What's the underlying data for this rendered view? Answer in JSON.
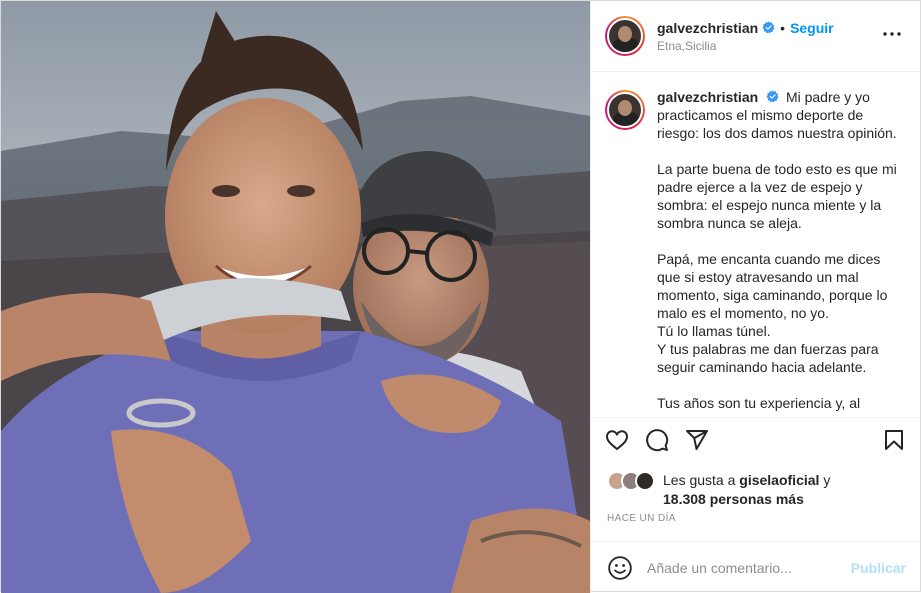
{
  "post": {
    "username": "galvezchristian",
    "verified": true,
    "follow_label": "Seguir",
    "location": "Etna,Sicilia",
    "more_label": "•••"
  },
  "caption": {
    "username": "galvezchristian",
    "paragraphs": [
      "Mi padre y yo practicamos el mismo deporte de riesgo: los dos damos nuestra opinión.",
      "La parte buena de todo esto es que mi padre ejerce a la vez de espejo y sombra: el espejo nunca miente y la sombra nunca se aleja.",
      "Papá, me encanta cuando me dices que si estoy atravesando un mal momento, siga caminando, porque lo malo es el momento, no yo.",
      "Tú lo llamas túnel.",
      "Y tus palabras me dan fuerzas para seguir caminando hacia adelante.",
      "Tus años son tu experiencia y, al"
    ]
  },
  "actions": {
    "icons": [
      "heart-icon",
      "comment-icon",
      "share-icon",
      "bookmark-icon"
    ]
  },
  "likes": {
    "prefix": "Les gusta a",
    "user": "giselaoficial",
    "connector": "y",
    "count": "18.308 personas más"
  },
  "timestamp": "HACE UN DÍA",
  "comment": {
    "placeholder": "Añade un comentario...",
    "publish_label": "Publicar"
  },
  "colors": {
    "accent": "#0095f6",
    "publish_disabled": "#b2dffc",
    "secondary_text": "#8e8e8e",
    "verified": "#3897f0"
  }
}
